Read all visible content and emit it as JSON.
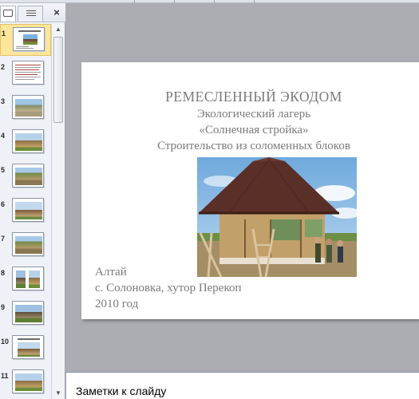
{
  "panel": {
    "tabs": [
      {
        "name": "Slides",
        "icon": "slide-icon"
      },
      {
        "name": "Outline",
        "icon": "outline-icon"
      }
    ],
    "close_label": "×",
    "thumbnails": [
      {
        "number": "1",
        "selected": true
      },
      {
        "number": "2",
        "selected": false
      },
      {
        "number": "3",
        "selected": false
      },
      {
        "number": "4",
        "selected": false
      },
      {
        "number": "5",
        "selected": false
      },
      {
        "number": "6",
        "selected": false
      },
      {
        "number": "7",
        "selected": false
      },
      {
        "number": "8",
        "selected": false
      },
      {
        "number": "9",
        "selected": false
      },
      {
        "number": "10",
        "selected": false
      },
      {
        "number": "11",
        "selected": false
      }
    ]
  },
  "slide": {
    "title": "РЕМЕСЛЕННЫЙ  ЭКОДОМ",
    "subtitle1": "Экологический лагерь",
    "subtitle2": "«Солнечная стройка»",
    "subtitle3": "Строительство из соломенных блоков",
    "place1": "Алтай",
    "place2": "с. Солоновка, хутор Перекоп",
    "place3": "2010 год"
  },
  "notes": {
    "placeholder": "Заметки к слайду"
  },
  "colors": {
    "selected_thumb": "#fde59a",
    "slide_text": "#7a7a7a",
    "workspace": "#abadb3"
  }
}
